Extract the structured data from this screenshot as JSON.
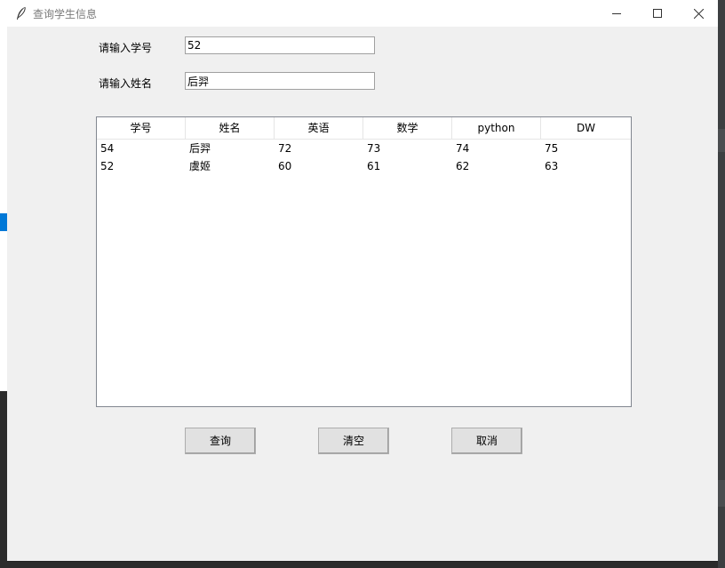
{
  "window": {
    "title": "查询学生信息"
  },
  "form": {
    "id_label": "请输入学号",
    "id_value": "52",
    "name_label": "请输入姓名",
    "name_value": "后羿"
  },
  "table": {
    "columns": [
      "学号",
      "姓名",
      "英语",
      "数学",
      "python",
      "DW"
    ],
    "rows": [
      [
        "54",
        "后羿",
        "72",
        "73",
        "74",
        "75"
      ],
      [
        "52",
        "虞姬",
        "60",
        "61",
        "62",
        "63"
      ]
    ]
  },
  "buttons": {
    "query": "查询",
    "clear": "清空",
    "cancel": "取消"
  },
  "colors": {
    "window_bg": "#f0f0f0",
    "titlebar_bg": "#ffffff",
    "button_bg": "#e1e1e1"
  }
}
